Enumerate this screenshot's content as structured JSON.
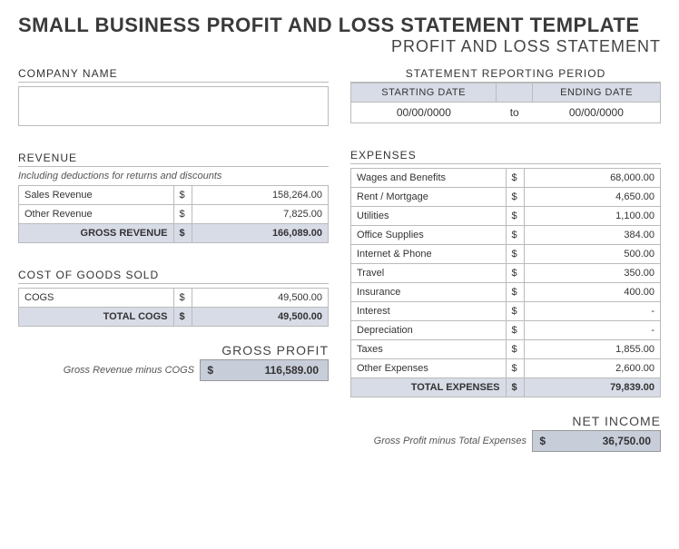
{
  "header": {
    "main_title": "SMALL BUSINESS PROFIT AND LOSS STATEMENT TEMPLATE",
    "sub_title": "PROFIT AND LOSS STATEMENT"
  },
  "company": {
    "heading": "COMPANY NAME"
  },
  "period": {
    "heading": "STATEMENT REPORTING PERIOD",
    "start_label": "STARTING DATE",
    "end_label": "ENDING DATE",
    "start_value": "00/00/0000",
    "to_label": "to",
    "end_value": "00/00/0000"
  },
  "revenue": {
    "heading": "REVENUE",
    "note": "Including deductions for returns and discounts",
    "rows": [
      {
        "label": "Sales Revenue",
        "cur": "$",
        "value": "158,264.00"
      },
      {
        "label": "Other Revenue",
        "cur": "$",
        "value": "7,825.00"
      }
    ],
    "total": {
      "label": "GROSS REVENUE",
      "cur": "$",
      "value": "166,089.00"
    }
  },
  "cogs": {
    "heading": "COST OF GOODS SOLD",
    "rows": [
      {
        "label": "COGS",
        "cur": "$",
        "value": "49,500.00"
      }
    ],
    "total": {
      "label": "TOTAL COGS",
      "cur": "$",
      "value": "49,500.00"
    }
  },
  "gross_profit": {
    "title": "GROSS PROFIT",
    "note": "Gross Revenue minus COGS",
    "cur": "$",
    "value": "116,589.00"
  },
  "expenses": {
    "heading": "EXPENSES",
    "rows": [
      {
        "label": "Wages and Benefits",
        "cur": "$",
        "value": "68,000.00"
      },
      {
        "label": "Rent / Mortgage",
        "cur": "$",
        "value": "4,650.00"
      },
      {
        "label": "Utilities",
        "cur": "$",
        "value": "1,100.00"
      },
      {
        "label": "Office Supplies",
        "cur": "$",
        "value": "384.00"
      },
      {
        "label": "Internet & Phone",
        "cur": "$",
        "value": "500.00"
      },
      {
        "label": "Travel",
        "cur": "$",
        "value": "350.00"
      },
      {
        "label": "Insurance",
        "cur": "$",
        "value": "400.00"
      },
      {
        "label": "Interest",
        "cur": "$",
        "value": "-"
      },
      {
        "label": "Depreciation",
        "cur": "$",
        "value": "-"
      },
      {
        "label": "Taxes",
        "cur": "$",
        "value": "1,855.00"
      },
      {
        "label": "Other Expenses",
        "cur": "$",
        "value": "2,600.00"
      }
    ],
    "total": {
      "label": "TOTAL EXPENSES",
      "cur": "$",
      "value": "79,839.00"
    }
  },
  "net_income": {
    "title": "NET INCOME",
    "note": "Gross Profit minus Total Expenses",
    "cur": "$",
    "value": "36,750.00"
  }
}
